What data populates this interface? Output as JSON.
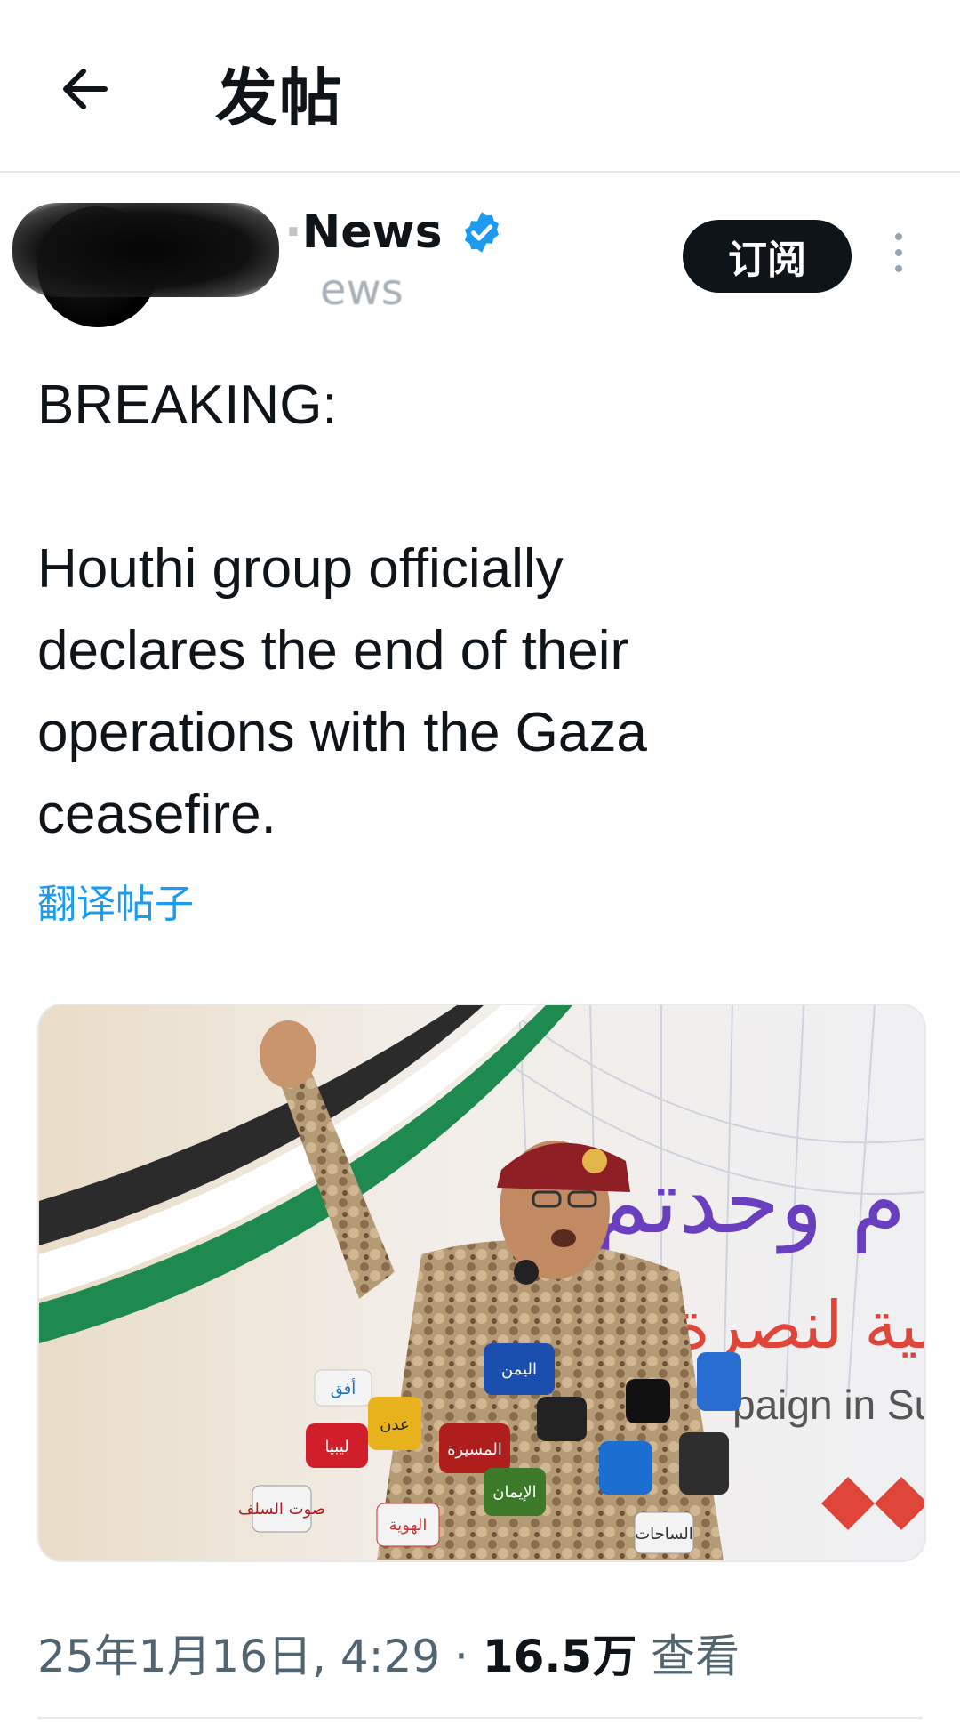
{
  "header": {
    "back_icon": "arrow-left-icon",
    "title": "发帖"
  },
  "author": {
    "name_visible": "News",
    "name_faded": "· ",
    "handle_visible": "ews",
    "verified_icon": "verified-badge-icon",
    "verified_color": "#1d9bf0",
    "subscribe_label": "订阅",
    "more_icon": "more-vertical-icon"
  },
  "tweet": {
    "text": "BREAKING:\n\nHouthi group officially\ndeclares the end of their\noperations with the Gaza\nceasefire.",
    "translate_label": "翻译帖子",
    "image_text": {
      "arabic_top": "م وحدتم",
      "arabic_middle": "طنية لنصرة الأقصى",
      "english_partial": "paign in Su",
      "mic_labels": [
        "أفق",
        "اليمن",
        "المسيرة",
        "ليبيا",
        "عدن",
        "الإيمان",
        "الهوية",
        "صوت السلف",
        "الساحات"
      ]
    },
    "date": "25年1月16日, 4:29",
    "separator": "·",
    "views_count": "16.5万",
    "views_label": "查看"
  },
  "colors": {
    "accent": "#1d9bf0",
    "text": "#0f1419",
    "muted": "#536471"
  }
}
